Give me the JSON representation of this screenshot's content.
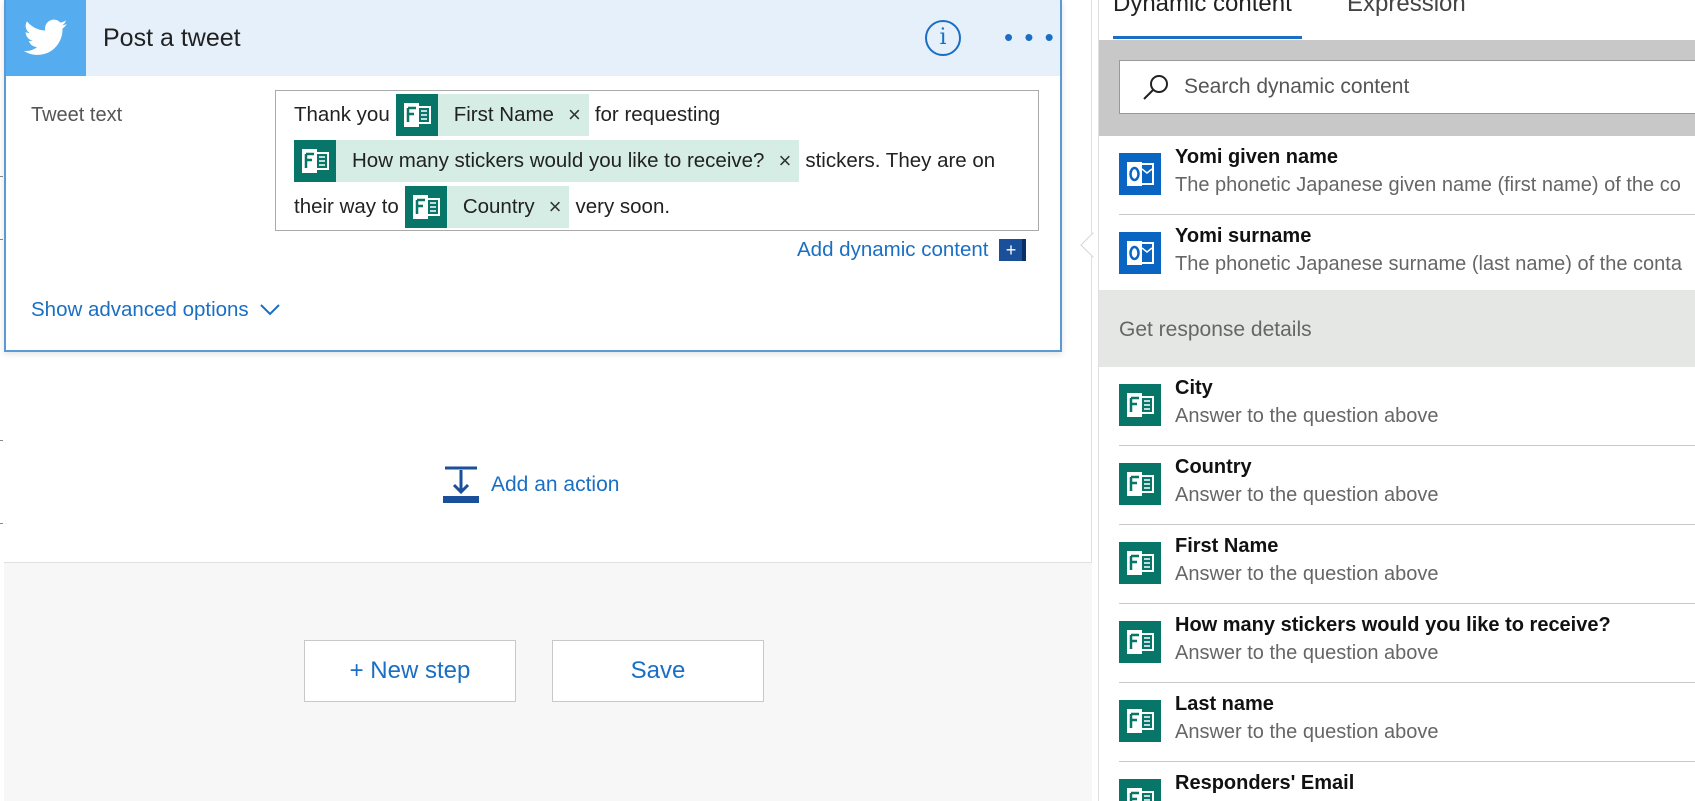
{
  "card": {
    "title": "Post a tweet",
    "field_label": "Tweet text",
    "tweet_text": {
      "line1_before": "Thank you",
      "token1": "First Name",
      "line1_after": "for requesting",
      "token2": "How many stickers would you like to receive?",
      "line2_after": "stickers. They are on",
      "line3_before": "their way to",
      "token3": "Country",
      "line3_after": "very soon."
    },
    "token_remove_glyph": "×",
    "add_dynamic_content": "Add dynamic content",
    "show_advanced": "Show advanced options"
  },
  "canvas": {
    "add_action": "Add an action",
    "new_step": "+ New step",
    "save": "Save"
  },
  "panel": {
    "tabs": [
      "Dynamic content",
      "Expression"
    ],
    "active_tab": "Dynamic content",
    "search_placeholder": "Search dynamic content",
    "outlook_items": [
      {
        "title": "Yomi given name",
        "desc": "The phonetic Japanese given name (first name) of the co",
        "icon": "outlook-icon"
      },
      {
        "title": "Yomi surname",
        "desc": "The phonetic Japanese surname (last name) of the conta",
        "icon": "outlook-icon"
      }
    ],
    "section_label": "Get response details",
    "forms_items": [
      {
        "title": "City",
        "desc": "Answer to the question above",
        "icon": "forms-icon"
      },
      {
        "title": "Country",
        "desc": "Answer to the question above",
        "icon": "forms-icon"
      },
      {
        "title": "First Name",
        "desc": "Answer to the question above",
        "icon": "forms-icon"
      },
      {
        "title": "How many stickers would you like to receive?",
        "desc": "Answer to the question above",
        "icon": "forms-icon"
      },
      {
        "title": "Last name",
        "desc": "Answer to the question above",
        "icon": "forms-icon"
      },
      {
        "title": "Responders' Email",
        "desc": "",
        "icon": "forms-icon"
      }
    ]
  },
  "colors": {
    "accent": "#1a6fc4",
    "twitter": "#55acee",
    "forms": "#077568",
    "outlook": "#0a64c2",
    "token_bg": "#d6ede6"
  }
}
